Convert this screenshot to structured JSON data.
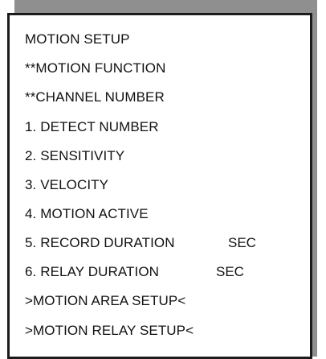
{
  "menu": {
    "title": "MOTION SETUP",
    "function": "**MOTION FUNCTION",
    "channel": "**CHANNEL NUMBER",
    "items": [
      {
        "label": "1. DETECT NUMBER"
      },
      {
        "label": "2. SENSITIVITY"
      },
      {
        "label": "3. VELOCITY"
      },
      {
        "label": "4. MOTION ACTIVE"
      },
      {
        "label": "5. RECORD DURATION",
        "unit": "SEC"
      },
      {
        "label": "6. RELAY DURATION",
        "unit": "SEC"
      }
    ],
    "area_setup": ">MOTION AREA SETUP<",
    "relay_setup": ">MOTION RELAY SETUP<"
  },
  "colors": {
    "shadow": "#8f8f8f",
    "border": "#1b1b1b",
    "background": "#ffffff",
    "text": "#111111"
  }
}
